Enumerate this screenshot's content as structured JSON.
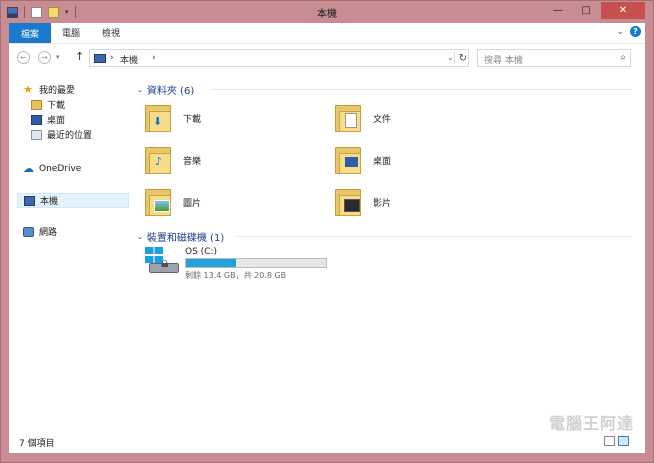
{
  "window": {
    "title": "本機",
    "controls": {
      "minimize": "—",
      "maximize": "□",
      "close": "✕"
    }
  },
  "ribbon": {
    "tabs": [
      "檔案",
      "電腦",
      "檢視"
    ]
  },
  "address": {
    "breadcrumb": [
      "本機"
    ],
    "search_placeholder": "搜尋 本機"
  },
  "nav_pane": {
    "favorites_label": "我的最愛",
    "favorites": [
      "下載",
      "桌面",
      "最近的位置"
    ],
    "onedrive": "OneDrive",
    "this_pc": "本機",
    "network": "網路"
  },
  "folders_group": {
    "header": "資料夾 (6)",
    "items": [
      "下載",
      "文件",
      "音樂",
      "桌面",
      "圖片",
      "影片"
    ]
  },
  "devices_group": {
    "header": "裝置和磁碟機 (1)",
    "drive": {
      "name": "OS (C:)",
      "free_text": "剩餘 13.4 GB，共 20.8 GB",
      "used_fraction": 0.356
    }
  },
  "status_bar": {
    "item_count": "7 個項目"
  },
  "watermark": "電腦王阿達",
  "colors": {
    "frame": "#c88d92",
    "accent": "#1979ca",
    "drive_bar": "#26a0da",
    "group_header": "#1e3f8f"
  }
}
